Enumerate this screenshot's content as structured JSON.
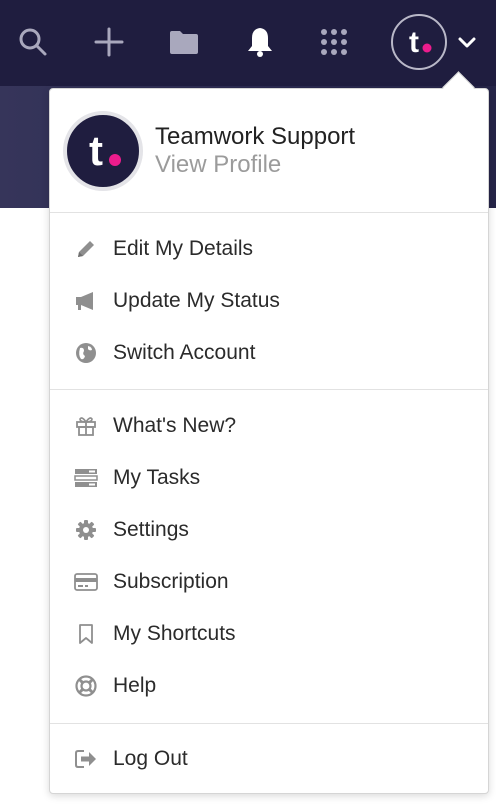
{
  "topbar": {
    "icons": [
      "search-icon",
      "plus-icon",
      "folder-icon",
      "bell-icon",
      "apps-grid-icon"
    ],
    "avatar_letter": "t",
    "colors": {
      "bar": "#1f1d3f",
      "icon": "#a9a8bd",
      "accent": "#ec1c8d"
    }
  },
  "profile": {
    "name": "Teamwork Support",
    "link": "View Profile"
  },
  "menu": {
    "group1": [
      {
        "label": "Edit My Details",
        "icon": "pencil-icon"
      },
      {
        "label": "Update My Status",
        "icon": "megaphone-icon"
      },
      {
        "label": "Switch Account",
        "icon": "globe-icon"
      }
    ],
    "group2": [
      {
        "label": "What's New?",
        "icon": "gift-icon"
      },
      {
        "label": "My Tasks",
        "icon": "tasks-icon"
      },
      {
        "label": "Settings",
        "icon": "gear-icon"
      },
      {
        "label": "Subscription",
        "icon": "credit-card-icon"
      },
      {
        "label": "My Shortcuts",
        "icon": "bookmark-icon"
      },
      {
        "label": "Help",
        "icon": "lifebuoy-icon"
      }
    ],
    "group3": [
      {
        "label": "Log Out",
        "icon": "logout-icon"
      }
    ]
  }
}
